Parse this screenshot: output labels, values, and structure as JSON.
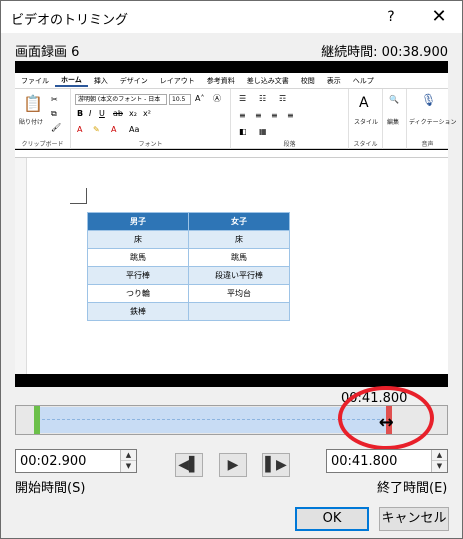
{
  "window": {
    "title": "ビデオのトリミング",
    "help": "?",
    "close": "✕"
  },
  "video": {
    "name": "画面録画 6",
    "duration_label": "継続時間: 00:38.900"
  },
  "word": {
    "tabs": [
      "ファイル",
      "ホーム",
      "挿入",
      "デザイン",
      "レイアウト",
      "参考資料",
      "差し込み文書",
      "校閲",
      "表示",
      "ヘルプ"
    ],
    "font_name": "游明朝 (本文のフォント - 日本",
    "font_size": "10.5",
    "groups": {
      "clipboard": "クリップボード",
      "font": "フォント",
      "paragraph": "段落",
      "style": "スタイル",
      "voice": "音声"
    },
    "buttons": {
      "paste": "貼り付け",
      "style": "スタイル",
      "edit": "編集",
      "dictate": "ディクテーション"
    },
    "table": {
      "headers": [
        "男子",
        "女子"
      ],
      "rows": [
        [
          "床",
          "床"
        ],
        [
          "跳馬",
          "跳馬"
        ],
        [
          "平行棒",
          "段違い平行棒"
        ],
        [
          "つり輪",
          "平均台"
        ],
        [
          "鉄棒",
          ""
        ]
      ]
    }
  },
  "timeline": {
    "current_time": "00:41.800",
    "trim_start_fraction": 0.05,
    "trim_end_fraction": 0.86
  },
  "start": {
    "value": "00:02.900",
    "label": "開始時間(S)"
  },
  "end": {
    "value": "00:41.800",
    "label": "終了時間(E)"
  },
  "playback": {
    "prev": "◀▌",
    "play": "▶",
    "next": "▌▶"
  },
  "buttons": {
    "ok": "OK",
    "cancel": "キャンセル"
  }
}
